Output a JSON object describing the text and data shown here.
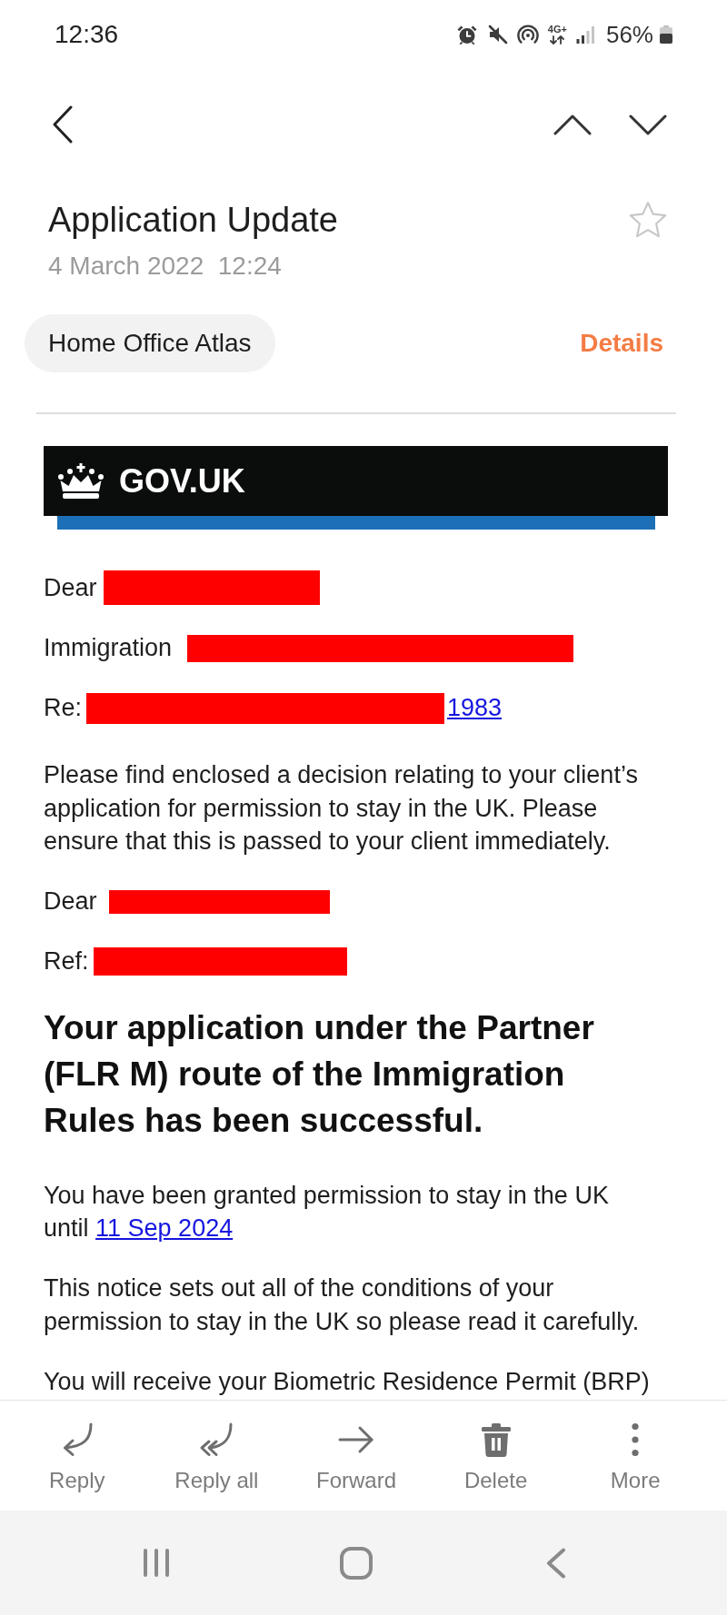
{
  "status_bar": {
    "time": "12:36",
    "network": "4G+",
    "battery": "56%"
  },
  "email": {
    "subject": "Application Update",
    "date": "4 March 2022  12:24",
    "starred": false,
    "sender": "Home Office Atlas",
    "details": "Details"
  },
  "message": {
    "banner": "GOV.UK",
    "blocks": [
      {
        "kind": "line",
        "text": "Dear",
        "redacted": true
      },
      {
        "kind": "line",
        "text": "Immigration",
        "redacted": true
      },
      {
        "kind": "line",
        "text": "Re:",
        "redacted": true,
        "link": "1983"
      },
      {
        "kind": "paragraph",
        "text": "Please find enclosed a decision relating to your client’s application for permission to stay in the UK. Please ensure that this is passed to your client immediately."
      },
      {
        "kind": "line",
        "text": "Dear",
        "redacted": true
      },
      {
        "kind": "line",
        "text": "Ref:",
        "redacted": true
      },
      {
        "kind": "heading",
        "text": "Your application under the Partner (FLR M) route of the Immigration Rules has been successful."
      },
      {
        "kind": "paragraph",
        "text": "You have been granted permission to stay in the UK until",
        "link": "11 Sep 2024"
      },
      {
        "kind": "paragraph",
        "text": "This notice sets out all of the conditions of your permission to stay in the UK so please read it carefully."
      },
      {
        "kind": "paragraph",
        "text": "You will receive your Biometric Residence Permit (BRP)"
      }
    ]
  },
  "actions": [
    "Reply",
    "Reply all",
    "Forward",
    "Delete",
    "More"
  ]
}
